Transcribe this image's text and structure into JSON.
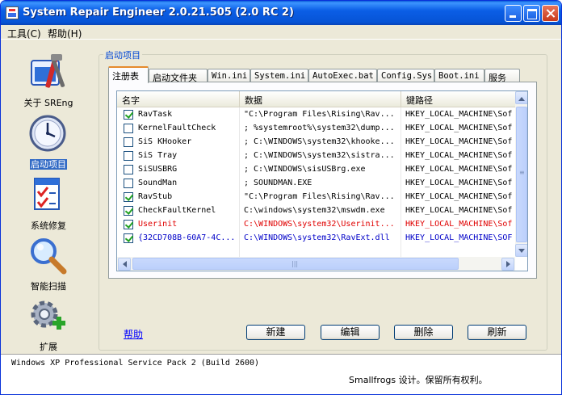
{
  "window": {
    "title": "System Repair Engineer 2.0.21.505 (2.0 RC 2)"
  },
  "menu": {
    "tools": "工具(C)",
    "help": "帮助(H)"
  },
  "nav": {
    "items": [
      {
        "label": "关于 SREng",
        "icon": "about-tools-icon",
        "selected": false
      },
      {
        "label": "启动项目",
        "icon": "clock-icon",
        "selected": true
      },
      {
        "label": "系统修复",
        "icon": "checklist-icon",
        "selected": false
      },
      {
        "label": "智能扫描",
        "icon": "magnifier-icon",
        "selected": false
      },
      {
        "label": "扩展",
        "icon": "gear-plus-icon",
        "selected": false
      }
    ]
  },
  "group": {
    "title": "启动项目"
  },
  "tabs": [
    "注册表",
    "启动文件夹",
    "Win.ini",
    "System.ini",
    "AutoExec.bat",
    "Config.Sys",
    "Boot.ini",
    "服务"
  ],
  "active_tab": "注册表",
  "list": {
    "columns": [
      "名字",
      "数据",
      "键路径"
    ],
    "rows": [
      {
        "checked": true,
        "name": "RavTask",
        "data": "\"C:\\Program Files\\Rising\\Rav...",
        "path": "HKEY_LOCAL_MACHINE\\Sof",
        "color": "normal"
      },
      {
        "checked": false,
        "name": "KernelFaultCheck",
        "data": "; %systemroot%\\system32\\dump...",
        "path": "HKEY_LOCAL_MACHINE\\Sof",
        "color": "normal"
      },
      {
        "checked": false,
        "name": "SiS KHooker",
        "data": "; C:\\WINDOWS\\system32\\khooke...",
        "path": "HKEY_LOCAL_MACHINE\\Sof",
        "color": "normal"
      },
      {
        "checked": false,
        "name": "SiS Tray",
        "data": "; C:\\WINDOWS\\system32\\sistra...",
        "path": "HKEY_LOCAL_MACHINE\\Sof",
        "color": "normal"
      },
      {
        "checked": false,
        "name": "SiSUSBRG",
        "data": "; C:\\WINDOWS\\sisUSBrg.exe",
        "path": "HKEY_LOCAL_MACHINE\\Sof",
        "color": "normal"
      },
      {
        "checked": false,
        "name": "SoundMan",
        "data": "; SOUNDMAN.EXE",
        "path": "HKEY_LOCAL_MACHINE\\Sof",
        "color": "normal"
      },
      {
        "checked": true,
        "name": "RavStub",
        "data": "\"C:\\Program Files\\Rising\\Rav...",
        "path": "HKEY_LOCAL_MACHINE\\Sof",
        "color": "normal"
      },
      {
        "checked": true,
        "name": "CheckFaultKernel",
        "data": "C:\\windows\\system32\\mswdm.exe",
        "path": "HKEY_LOCAL_MACHINE\\Sof",
        "color": "normal"
      },
      {
        "checked": true,
        "name": "Userinit",
        "data": "C:\\WINDOWS\\system32\\Userinit...",
        "path": "HKEY_LOCAL_MACHINE\\Sof",
        "color": "red"
      },
      {
        "checked": true,
        "name": "{32CD708B-60A7-4C...",
        "data": "C:\\WINDOWS\\system32\\RavExt.dll",
        "path": "HKEY_LOCAL_MACHINE\\SOF",
        "color": "blue"
      }
    ]
  },
  "help_link": "帮助",
  "buttons": {
    "new": "新建",
    "edit": "编辑",
    "delete": "删除",
    "refresh": "刷新"
  },
  "status": {
    "os": "Windows XP Professional Service Pack 2 (Build 2600)",
    "copyright": "Smallfrogs 设计。保留所有权利。"
  },
  "colors": {
    "title_bar": "#0a5bd8",
    "selection": "#316ac5",
    "link": "#0000ff",
    "alert_red": "#e00000",
    "highlight_blue": "#0000c8"
  }
}
